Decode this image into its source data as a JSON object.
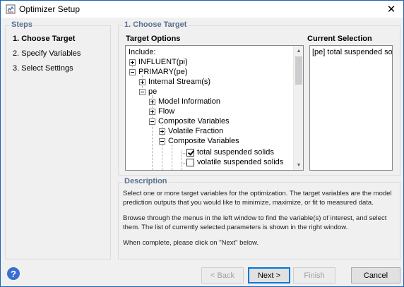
{
  "window": {
    "title": "Optimizer Setup",
    "close_glyph": "✕"
  },
  "steps": {
    "legend": "Steps",
    "items": [
      "1. Choose Target",
      "2. Specify Variables",
      "3. Select Settings"
    ]
  },
  "target": {
    "legend": "1. Choose Target",
    "options_header": "Target Options",
    "selection_header": "Current Selection",
    "tree": [
      {
        "label": "Include:"
      },
      {
        "label": "INFLUENT(pi)"
      },
      {
        "label": "PRIMARY(pe)"
      },
      {
        "label": "Internal Stream(s)"
      },
      {
        "label": "pe"
      },
      {
        "label": "Model Information"
      },
      {
        "label": "Flow"
      },
      {
        "label": "Composite Variables"
      },
      {
        "label": "Volatile Fraction"
      },
      {
        "label": "Composite Variables"
      },
      {
        "label": "total suspended solids",
        "checked": true
      },
      {
        "label": "volatile suspended solids",
        "checked": false
      }
    ],
    "current_selection": [
      "[pe] total suspended solids"
    ]
  },
  "description": {
    "legend": "Description",
    "paragraphs": [
      "Select one or more target variables for the optimization. The target variables are the model prediction outputs that you would like to minimize, maximize, or fit to measured data.",
      "Browse through the menus in the left window to find the variable(s) of interest, and select them. The list of currently selected parameters is shown in the right window.",
      "When complete, please click on \"Next\" below."
    ]
  },
  "buttons": {
    "back": "< Back",
    "next": "Next >",
    "finish": "Finish",
    "cancel": "Cancel"
  },
  "help_glyph": "?",
  "colors": {
    "legend": "#5a7090",
    "accent": "#0078d7",
    "window_border": "#1e64b4"
  }
}
